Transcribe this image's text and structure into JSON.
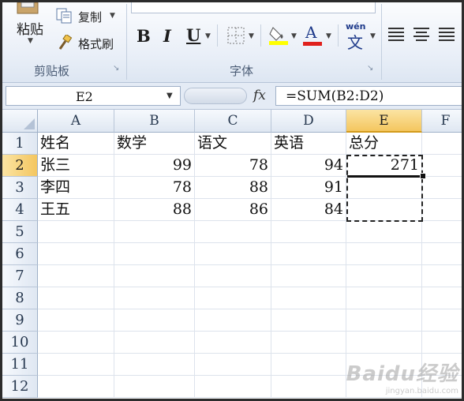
{
  "clipboard": {
    "paste_label": "粘贴",
    "copy_label": "复制",
    "format_painter_label": "格式刷",
    "group_label": "剪贴板"
  },
  "font_group": {
    "bold": "B",
    "italic": "I",
    "underline": "U",
    "font_color_glyph": "A",
    "phonetic_glyph": "wén",
    "phonetic_char": "文",
    "group_label": "字体"
  },
  "formula_bar": {
    "name_box": "E2",
    "fx": "fx",
    "formula": "=SUM(B2:D2)"
  },
  "columns": [
    "A",
    "B",
    "C",
    "D",
    "E",
    "F"
  ],
  "active_column": "E",
  "rows": [
    "1",
    "2",
    "3",
    "4",
    "5",
    "6",
    "7",
    "8",
    "9",
    "10",
    "11",
    "12"
  ],
  "active_row": "2",
  "cells": {
    "A1": "姓名",
    "B1": "数学",
    "C1": "语文",
    "D1": "英语",
    "E1": "总分",
    "A2": "张三",
    "B2": "99",
    "C2": "78",
    "D2": "94",
    "E2": "271",
    "A3": "李四",
    "B3": "78",
    "C3": "88",
    "D3": "91",
    "A4": "王五",
    "B4": "88",
    "C4": "86",
    "D4": "84"
  },
  "colors": {
    "accent_selection": "#f4c65f",
    "font_color": "#e0201c",
    "fill_color": "#ffff00"
  },
  "watermark": {
    "brand": "Baidu经验",
    "url": "jingyan.baidu.com"
  }
}
